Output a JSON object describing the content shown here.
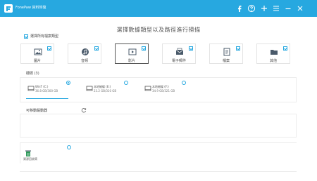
{
  "titlebar": {
    "app_name": "FonePaw 資料恢復",
    "color": "#27a8e0",
    "icons": [
      "facebook-icon",
      "help-icon",
      "plus-icon",
      "menu-icon",
      "minimize-icon",
      "close-icon"
    ]
  },
  "main": {
    "heading": "選擇數據類型以及路徑進行掃描",
    "select_all_label": "選擇所有檔案類型",
    "file_types": [
      {
        "label": "圖片",
        "icon": "image-icon",
        "checked": true,
        "active": false
      },
      {
        "label": "音頻",
        "icon": "audio-icon",
        "checked": true,
        "active": false
      },
      {
        "label": "影片",
        "icon": "video-icon",
        "checked": true,
        "active": true
      },
      {
        "label": "電子郵件",
        "icon": "email-icon",
        "checked": true,
        "active": false
      },
      {
        "label": "檔案",
        "icon": "document-icon",
        "checked": true,
        "active": false
      },
      {
        "label": "其他",
        "icon": "folder-icon",
        "checked": true,
        "active": false
      }
    ]
  },
  "drives": {
    "title": "硬碟 (3)",
    "items": [
      {
        "name": "WinT (C:)",
        "size": "36.8 GB/300 GB",
        "selected": true
      },
      {
        "name": "本地磁碟 (E:)",
        "size": "23.2 GB/310 GB",
        "selected": false
      },
      {
        "name": "本地磁碟 (F:)",
        "size": "34.9 GB/321 GB",
        "selected": false
      }
    ]
  },
  "removable": {
    "title": "可移動驅動器"
  },
  "recycle_bin": {
    "label": "資源回收筒"
  }
}
